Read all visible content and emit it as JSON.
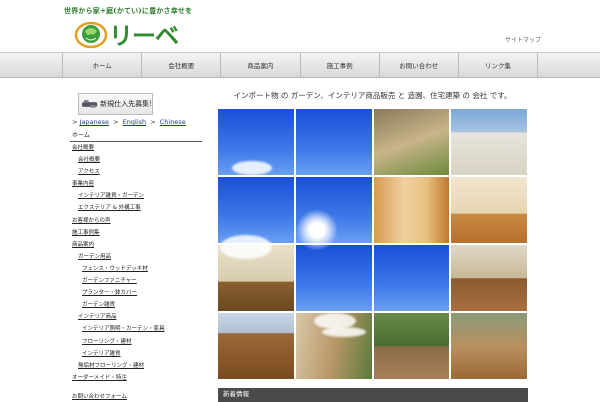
{
  "header": {
    "tagline": "世界から家+庭(かてい)に豊かさ幸せを",
    "logo_text": "リーベ",
    "sitemap_label": "サイトマップ"
  },
  "nav": {
    "items": [
      "ホーム",
      "会社概要",
      "商品案内",
      "施工事例",
      "お問い合わせ",
      "リンク集"
    ]
  },
  "sidebar": {
    "recruit_banner": "新規仕入先募集!",
    "languages": {
      "prefix": ">",
      "items": [
        "Japanese",
        "English",
        "Chinese"
      ]
    },
    "category_title": "ホーム",
    "menu": [
      {
        "label": "会社概要",
        "level": 0
      },
      {
        "label": "会社概要",
        "level": 1
      },
      {
        "label": "アクセス",
        "level": 1
      },
      {
        "label": "事業内容",
        "level": 0
      },
      {
        "label": "インテリア雑貨・ガーデン",
        "level": 1
      },
      {
        "label": "エクステリア & 外構工事",
        "level": 1
      },
      {
        "label": "お客様からの声",
        "level": 0
      },
      {
        "label": "施工事例集",
        "level": 0
      },
      {
        "label": "商品案内",
        "level": 0
      },
      {
        "label": "ガーデン用品",
        "level": 1
      },
      {
        "label": "フェンス・ウッドデッキ材",
        "level": 2
      },
      {
        "label": "ガーデンファニチャー",
        "level": 2
      },
      {
        "label": "プランター・鉢カバー",
        "level": 2
      },
      {
        "label": "ガーデン雑貨",
        "level": 2
      },
      {
        "label": "インテリア商品",
        "level": 1
      },
      {
        "label": "インテリア照明・カーテン・家具",
        "level": 2
      },
      {
        "label": "フローリング・建材",
        "level": 2
      },
      {
        "label": "インテリア雑貨",
        "level": 2
      },
      {
        "label": "無垢材フローリング・建材",
        "level": 1
      },
      {
        "label": "オーダーメイド・特注",
        "level": 0
      }
    ],
    "footer_link": "お問い合わせフォーム"
  },
  "main": {
    "intro": "インポート物 の ガーデン、インテリア商品販売 と 造園、住宅建築 の 会社 です。",
    "section_title": "新着情報"
  },
  "colors": {
    "brand_green": "#2e8b2e",
    "nav_bg": "#e2e2e2",
    "link_blue": "#1a3c8c",
    "section_bar": "#4a4a4a"
  }
}
